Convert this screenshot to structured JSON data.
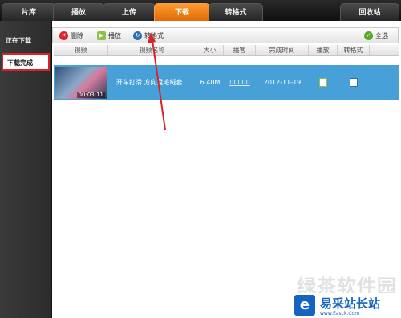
{
  "tabs": [
    {
      "label": "片库"
    },
    {
      "label": "播放"
    },
    {
      "label": "上传"
    },
    {
      "label": "下载"
    },
    {
      "label": "转格式"
    },
    {
      "label": "回收站"
    }
  ],
  "sidebar": {
    "items": [
      {
        "label": "正在下载"
      },
      {
        "label": "下载完成"
      }
    ]
  },
  "toolbar": {
    "delete_label": "删除",
    "play_label": "播放",
    "convert_label": "转格式",
    "select_all_label": "全选"
  },
  "table": {
    "headers": [
      "视频",
      "视频名称",
      "大小",
      "播客",
      "完成时间",
      "播放",
      "转格式"
    ],
    "rows": [
      {
        "duration": "00:03:11",
        "name": "开车打滑  方向盘毛绒套...",
        "size": "6.40M",
        "podcast": "00000",
        "completed": "2012-11-19"
      }
    ]
  },
  "watermark": {
    "big_text": "绿茶软件园",
    "logo_letter": "e",
    "brand_text": "易采站长站",
    "url": "www.Easck.Com"
  },
  "colors": {
    "active_tab": "#f07b0c",
    "row_highlight": "#48a0d8",
    "annotation": "#d9232a"
  }
}
